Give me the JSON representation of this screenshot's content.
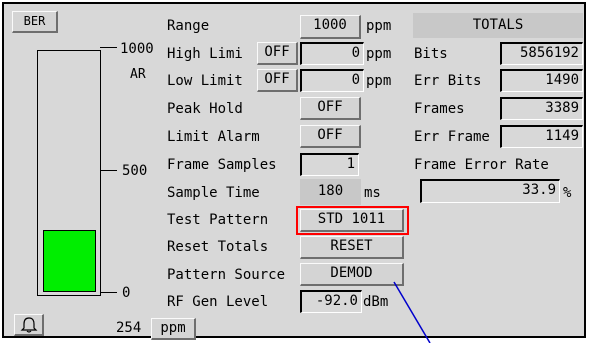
{
  "meter": {
    "ber_button": "BER",
    "scale_top": "1000",
    "scale_unit": "AR",
    "scale_mid": "500",
    "scale_bottom": "0",
    "level_fraction": 0.254,
    "reading_value": "254",
    "reading_unit": "ppm",
    "bell_icon": "bell-icon"
  },
  "settings": {
    "range_label": "Range",
    "range_value": "1000",
    "range_unit": "ppm",
    "high_limit_label": "High Limi",
    "high_limit_toggle": "OFF",
    "high_limit_value": "0",
    "high_limit_unit": "ppm",
    "low_limit_label": "Low Limit",
    "low_limit_toggle": "OFF",
    "low_limit_value": "0",
    "low_limit_unit": "ppm",
    "peak_hold_label": "Peak Hold",
    "peak_hold_value": "OFF",
    "limit_alarm_label": "Limit Alarm",
    "limit_alarm_value": "OFF",
    "frame_samples_label": "Frame Samples",
    "frame_samples_value": "1",
    "sample_time_label": "Sample Time",
    "sample_time_value": "180",
    "sample_time_unit": "ms",
    "test_pattern_label": "Test Pattern",
    "test_pattern_value": "STD 1011",
    "reset_totals_label": "Reset Totals",
    "reset_totals_button": "RESET",
    "pattern_source_label": "Pattern Source",
    "pattern_source_value": "DEMOD",
    "rf_gen_label": "RF Gen Level",
    "rf_gen_value": "-92.0",
    "rf_gen_unit": "dBm"
  },
  "totals": {
    "header": "TOTALS",
    "bits_label": "Bits",
    "bits_value": "5856192",
    "err_bits_label": "Err Bits",
    "err_bits_value": "1490",
    "frames_label": "Frames",
    "frames_value": "3389",
    "err_frames_label": "Err Frame",
    "err_frames_value": "1149",
    "fer_label": "Frame Error Rate",
    "fer_value": "33.9",
    "fer_unit": "%"
  },
  "colors": {
    "highlight": "#ff0000",
    "annotation_line": "#0000cc",
    "bar_fill": "#00ee00"
  }
}
